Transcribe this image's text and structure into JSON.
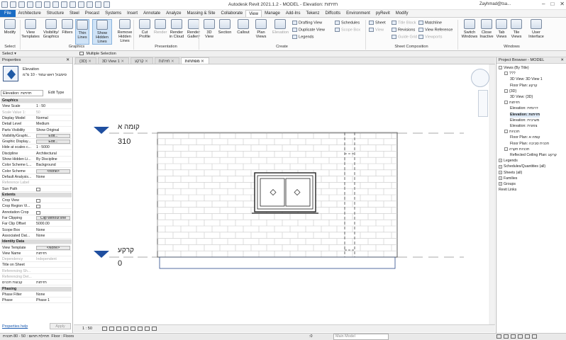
{
  "app": {
    "title": "Autodesk Revit 2021.1.2 - MODEL - Elevation: חזיתות",
    "user": "Zayhmad@tsa...",
    "window_controls": [
      "–",
      "□",
      "✕"
    ]
  },
  "menu_tabs": [
    "File",
    "Architecture",
    "Structure",
    "Steel",
    "Precast",
    "Systems",
    "Insert",
    "Annotate",
    "Analyze",
    "Massing & Site",
    "Collaborate",
    "View",
    "Manage",
    "Add-Ins",
    "Tekenz",
    "Diffcotts",
    "Environment",
    "pyRevit",
    "Modify"
  ],
  "active_menu_tab": "View",
  "ribbon": {
    "buttons": [
      {
        "label": "Modify",
        "icon": "cursor-arrow-icon"
      },
      {
        "label": "View Templates",
        "icon": "view-template-icon"
      },
      {
        "label": "Visibility/ Graphics",
        "icon": "visibility-graphics-icon"
      },
      {
        "label": "Filters",
        "icon": "filter-icon"
      },
      {
        "label": "Thin Lines",
        "icon": "thin-lines-icon"
      },
      {
        "label": "Show Hidden Lines",
        "icon": "show-hidden-lines-icon"
      },
      {
        "label": "Remove Hidden Lines",
        "icon": "remove-hidden-lines-icon"
      },
      {
        "label": "Cut Profile",
        "icon": "cut-profile-icon"
      },
      {
        "label": "Render",
        "icon": "render-icon"
      },
      {
        "label": "Render in Cloud",
        "icon": "render-cloud-icon"
      },
      {
        "label": "Render Gallery",
        "icon": "render-gallery-icon"
      },
      {
        "label": "3D View",
        "icon": "3d-view-icon"
      },
      {
        "label": "Section",
        "icon": "section-icon"
      },
      {
        "label": "Callout",
        "icon": "callout-icon"
      },
      {
        "label": "Plan Views",
        "icon": "plan-views-icon"
      },
      {
        "label": "Elevation",
        "icon": "elevation-icon"
      },
      {
        "label": "Switch Windows",
        "icon": "switch-windows-icon"
      },
      {
        "label": "Close Inactive",
        "icon": "close-inactive-icon"
      },
      {
        "label": "Tab Views",
        "icon": "tab-views-icon"
      },
      {
        "label": "Tile Views",
        "icon": "tile-views-icon"
      },
      {
        "label": "User Interface",
        "icon": "user-interface-icon"
      }
    ],
    "small": {
      "drafting_view": "Drafting View",
      "duplicate_view": "Duplicate View",
      "legends": "Legends",
      "schedules": "Schedules",
      "scope_box": "Scope Box",
      "sheet": "Sheet",
      "title_block": "Title Block",
      "matchline": "Matchline",
      "view": "View",
      "revisions": "Revisions",
      "view_reference": "View Reference",
      "guide_grid": "Guide Grid",
      "viewports": "Viewports"
    },
    "groups": [
      "Select",
      "Graphics",
      "Presentation",
      "Create",
      "Sheet Composition",
      "Windows"
    ]
  },
  "selbar": {
    "select": "Select ▾"
  },
  "optbar": {
    "multiple_selection": "Multiple Selection"
  },
  "properties": {
    "title": "Properties",
    "type_family": "Elevation",
    "type_name": "סימבול ראש עמוד - 10 מ\"מ",
    "selector": "Elevation: חזיתות",
    "edit_type": "Edit Type",
    "rows": [
      {
        "k": "Graphics",
        "cat": true
      },
      {
        "k": "View Scale",
        "v": "1 : 50"
      },
      {
        "k": "Scale Value 1:",
        "v": "50",
        "dis": true
      },
      {
        "k": "Display Model",
        "v": "Normal"
      },
      {
        "k": "Detail Level",
        "v": "Medium"
      },
      {
        "k": "Parts Visibility",
        "v": "Show Original"
      },
      {
        "k": "Visibility/Graphi...",
        "v": "Edit...",
        "btn": true
      },
      {
        "k": "Graphic Display...",
        "v": "Edit...",
        "btn": true
      },
      {
        "k": "Hide at scales c...",
        "v": "1 : 5000"
      },
      {
        "k": "Discipline",
        "v": "Architectural"
      },
      {
        "k": "Show Hidden Li...",
        "v": "By Discipline"
      },
      {
        "k": "Color Scheme L...",
        "v": "Background"
      },
      {
        "k": "Color Scheme",
        "v": "<none>",
        "btn": true
      },
      {
        "k": "Default Analysis...",
        "v": "None"
      },
      {
        "k": "Reference Label",
        "v": "",
        "dis": true
      },
      {
        "k": "Sun Path",
        "v": "",
        "box": true
      },
      {
        "k": "Extents",
        "cat": true
      },
      {
        "k": "Crop View",
        "v": "",
        "box": true
      },
      {
        "k": "Crop Region Vi...",
        "v": "",
        "box": true
      },
      {
        "k": "Annotation Crop",
        "v": "",
        "box": true
      },
      {
        "k": "Far Clipping",
        "v": "Clip without line",
        "btn": true
      },
      {
        "k": "Far Clip Offset",
        "v": "5000.00"
      },
      {
        "k": "Scope Box",
        "v": "None"
      },
      {
        "k": "Associated Dat...",
        "v": "None"
      },
      {
        "k": "Identity Data",
        "cat": true
      },
      {
        "k": "View Template",
        "v": "<None>",
        "btn": true
      },
      {
        "k": "View Name",
        "v": "חזיתות"
      },
      {
        "k": "Dependency",
        "v": "Independent",
        "dis": true
      },
      {
        "k": "Title on Sheet",
        "v": ""
      },
      {
        "k": "Referencing Sh...",
        "v": "",
        "dis": true
      },
      {
        "k": "Referencing Det...",
        "v": "",
        "dis": true
      },
      {
        "k": "קבוצת תכנים",
        "v": "חזיתות"
      },
      {
        "k": "Phasing",
        "cat": true
      },
      {
        "k": "Phase Filter",
        "v": "None"
      },
      {
        "k": "Phase",
        "v": "Phase 1"
      }
    ],
    "help": "Properties help",
    "apply": "Apply"
  },
  "view_tabs": [
    {
      "label": "{3D}",
      "active": false
    },
    {
      "label": "3D View 1",
      "active": false
    },
    {
      "label": "קרקע",
      "active": false
    },
    {
      "label": "חזיתות",
      "active": false
    },
    {
      "label": "מפתחות",
      "active": true
    }
  ],
  "drawing": {
    "levels": [
      {
        "name": "קומה א",
        "elev": "310"
      },
      {
        "name": "קרקע",
        "elev": "0"
      }
    ]
  },
  "browser": {
    "title": "Project Browser - MODEL",
    "items": [
      {
        "t": "Views (By Title)",
        "lvl": 0,
        "tg": "-"
      },
      {
        "t": "???",
        "lvl": 1,
        "tg": "-"
      },
      {
        "t": "3D View: 3D View 1",
        "lvl": 2
      },
      {
        "t": "Floor Plan: קרקע",
        "lvl": 2
      },
      {
        "t": "{3D}",
        "lvl": 1,
        "tg": "-"
      },
      {
        "t": "3D View: {3D}",
        "lvl": 2
      },
      {
        "t": "חזיתות",
        "lvl": 1,
        "tg": "-"
      },
      {
        "t": "Elevation: דרומית",
        "lvl": 2
      },
      {
        "t": "Elevation: חזיתות",
        "lvl": 2,
        "sel": true
      },
      {
        "t": "Elevation: מערבית",
        "lvl": 2
      },
      {
        "t": "Elevation: צפונית",
        "lvl": 2
      },
      {
        "t": "תכניות",
        "lvl": 1,
        "tg": "-"
      },
      {
        "t": "Floor Plan: קומה א",
        "lvl": 2
      },
      {
        "t": "Floor Plan: תכנית סביבה",
        "lvl": 2
      },
      {
        "t": "תכניות תקרה",
        "lvl": 1,
        "tg": "-"
      },
      {
        "t": "Reflected Ceiling Plan: קרקע",
        "lvl": 2
      },
      {
        "t": "Legends",
        "lvl": 0,
        "tg": "+"
      },
      {
        "t": "Schedules/Quantities (all)",
        "lvl": 0,
        "tg": "+"
      },
      {
        "t": "Sheets (all)",
        "lvl": 0,
        "tg": "+"
      },
      {
        "t": "Families",
        "lvl": 0,
        "tg": "+"
      },
      {
        "t": "Groups",
        "lvl": 0,
        "tg": "+"
      },
      {
        "t": "Revit Links",
        "lvl": 0,
        "tg": ""
      }
    ]
  },
  "viewctrl": {
    "scale": "1 : 50"
  },
  "status": {
    "left": "תחילת תחום : 50 - 80 תכנית ‎ Floor : Floors",
    "main_model": "Main Model",
    "zero": ":0"
  }
}
